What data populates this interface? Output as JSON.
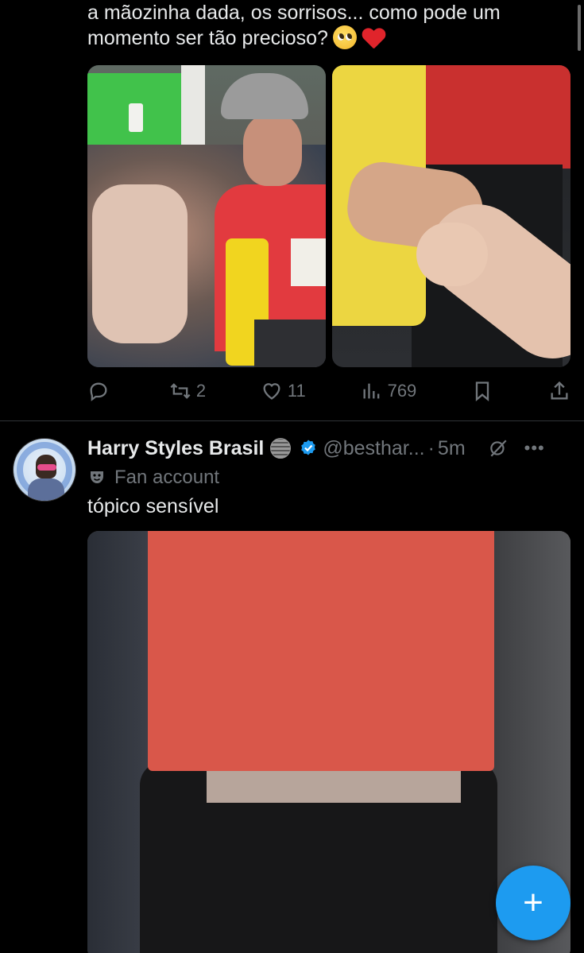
{
  "tweet1": {
    "text_line1": "a mãozinha dada, os sorrisos... como pode um",
    "text_line2": "momento ser tão precioso?",
    "emojis": [
      "pleading-face-emoji",
      "red-heart-emoji"
    ],
    "actions": {
      "reply_count": "",
      "retweet_count": "2",
      "like_count": "11",
      "views_count": "769"
    }
  },
  "tweet2": {
    "display_name": "Harry Styles Brasil",
    "handle": "@besthar...",
    "separator": "·",
    "time": "5m",
    "label": "Fan account",
    "text": "tópico sensível"
  },
  "colors": {
    "background": "#000000",
    "text_primary": "#e7e9ea",
    "text_secondary": "#71767b",
    "accent": "#1d9bf0",
    "divider": "#2f3336"
  },
  "fab": {
    "icon": "plus-icon"
  }
}
